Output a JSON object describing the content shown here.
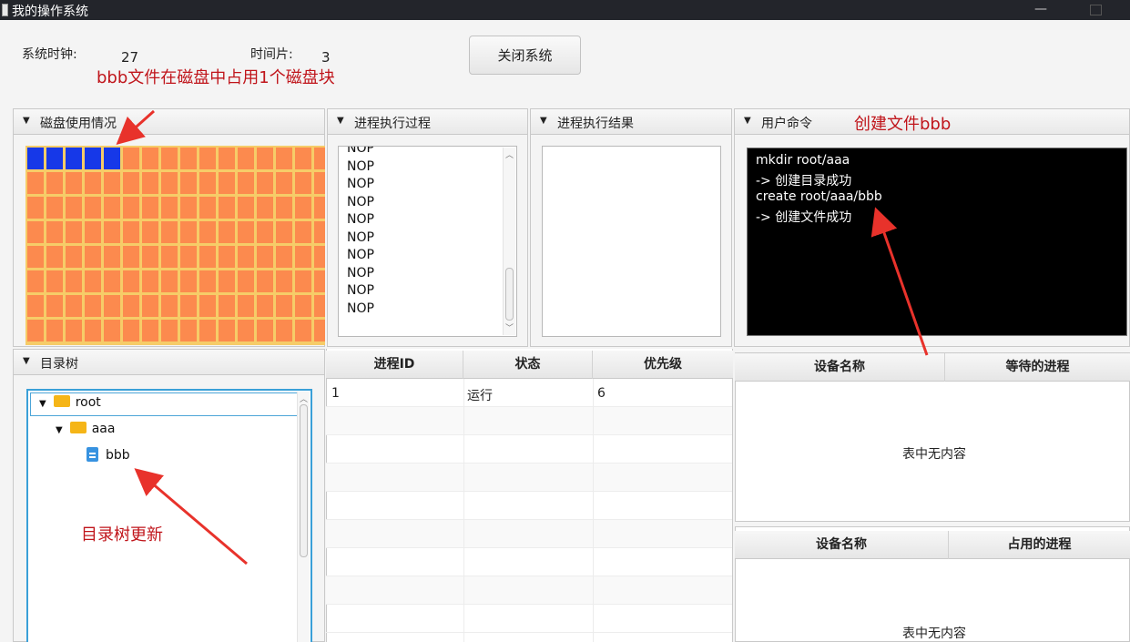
{
  "window": {
    "title": "我的操作系统",
    "minimize_glyph": "—"
  },
  "top": {
    "clock_label": "系统时钟:",
    "clock_value": "27",
    "slice_label": "时间片:",
    "slice_value": "3",
    "shutdown_label": "关闭系统"
  },
  "annotations": {
    "disk": "bbb文件在磁盘中占用1个磁盘块",
    "command": "创建文件bbb",
    "tree": "目录树更新",
    "color": "#c0151b"
  },
  "panes": {
    "disk_usage": "磁盘使用情况",
    "process_trace": "进程执行过程",
    "process_result": "进程执行结果",
    "user_command": "用户命令",
    "dir_tree": "目录树"
  },
  "disk": {
    "used_blocks": 5,
    "columns": 16,
    "rows": 8,
    "used_color": "#1638e8",
    "free_color": "#fc8a4e",
    "grid_color": "#f6cc68"
  },
  "process_trace_lines": [
    "NOP",
    "NOP",
    "NOP",
    "NOP",
    "NOP",
    "NOP",
    "NOP",
    "NOP",
    "NOP",
    "NOP"
  ],
  "console_lines": [
    "mkdir root/aaa",
    "-> 创建目录成功",
    "create root/aaa/bbb",
    "-> 创建文件成功"
  ],
  "tree": {
    "root": "root",
    "aaa": "aaa",
    "bbb": "bbb"
  },
  "process_table": {
    "headers": [
      "进程ID",
      "状态",
      "优先级"
    ],
    "rows": [
      [
        "1",
        "运行",
        "6"
      ]
    ]
  },
  "device_wait_table": {
    "headers": [
      "设备名称",
      "等待的进程"
    ],
    "empty_text": "表中无内容"
  },
  "device_use_table": {
    "headers": [
      "设备名称",
      "占用的进程"
    ],
    "empty_text": "表中无内容"
  }
}
